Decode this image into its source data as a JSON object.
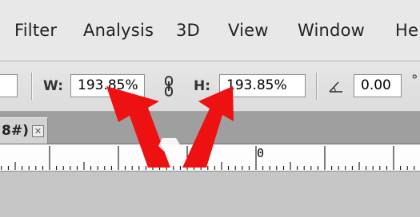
{
  "menu": {
    "items": [
      "Filter",
      "Analysis",
      "3D",
      "View",
      "Window",
      "Hel"
    ]
  },
  "options": {
    "width_label": "W:",
    "width_value": "193.85%",
    "height_label": "H:",
    "height_value": "193.85%",
    "angle_value": "0.00",
    "angle_unit": "°"
  },
  "tab": {
    "label": "8#)",
    "close_glyph": "✕"
  },
  "ruler": {
    "zero_label": "0"
  },
  "annotation": {
    "arrow_color": "#ee1111"
  }
}
